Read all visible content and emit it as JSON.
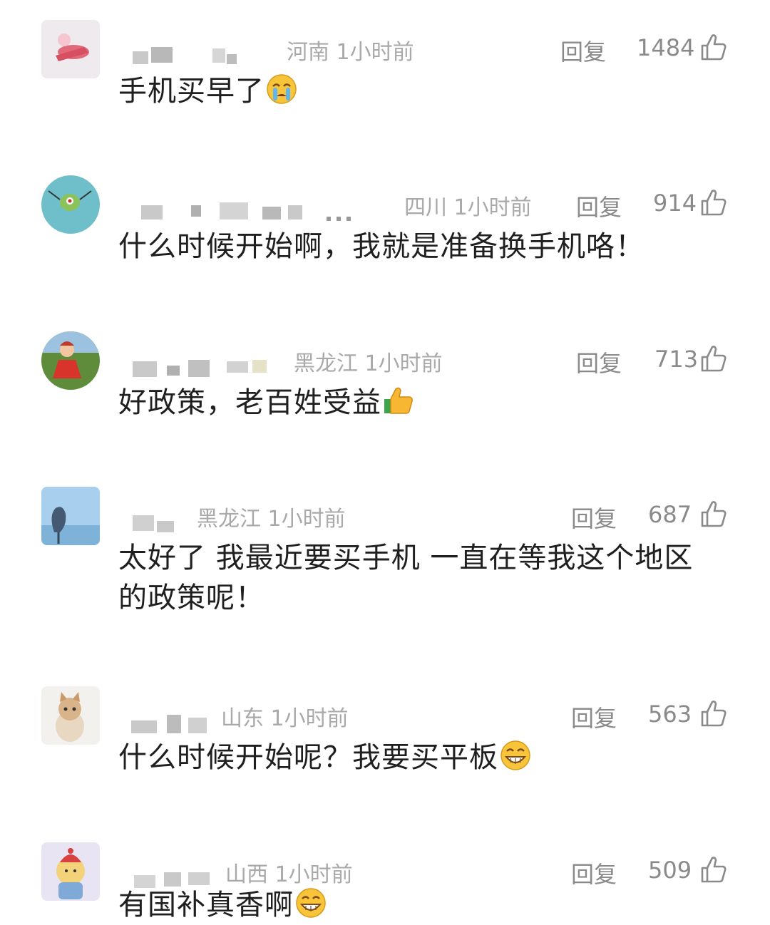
{
  "comments": [
    {
      "location_time": "河南 1小时前",
      "reply": "回复",
      "likes": "1484",
      "text": "手机买早了",
      "emoji": "crying-face"
    },
    {
      "location_time": "四川 1小时前",
      "reply": "回复",
      "likes": "914",
      "text": "什么时候开始啊，我就是准备换手机咯！",
      "emoji": ""
    },
    {
      "location_time": "黑龙江 1小时前",
      "reply": "回复",
      "likes": "713",
      "text": "好政策，老百姓受益",
      "emoji": "thumbs-up"
    },
    {
      "location_time": "黑龙江 1小时前",
      "reply": "回复",
      "likes": "687",
      "text": "太好了 我最近要买手机 一直在等我这个地区的政策呢！",
      "emoji": ""
    },
    {
      "location_time": "山东 1小时前",
      "reply": "回复",
      "likes": "563",
      "text": "什么时候开始呢？我要买平板",
      "emoji": "grinning-face"
    },
    {
      "location_time": "山西 1小时前",
      "reply": "回复",
      "likes": "509",
      "text": "有国补真香啊",
      "emoji": "grinning-face"
    }
  ],
  "icons": {
    "like": "thumbs-up-outline-icon"
  },
  "colors": {
    "meta": "#a9a9a9",
    "action": "#8a8a8a",
    "text": "#1f1f1f"
  }
}
